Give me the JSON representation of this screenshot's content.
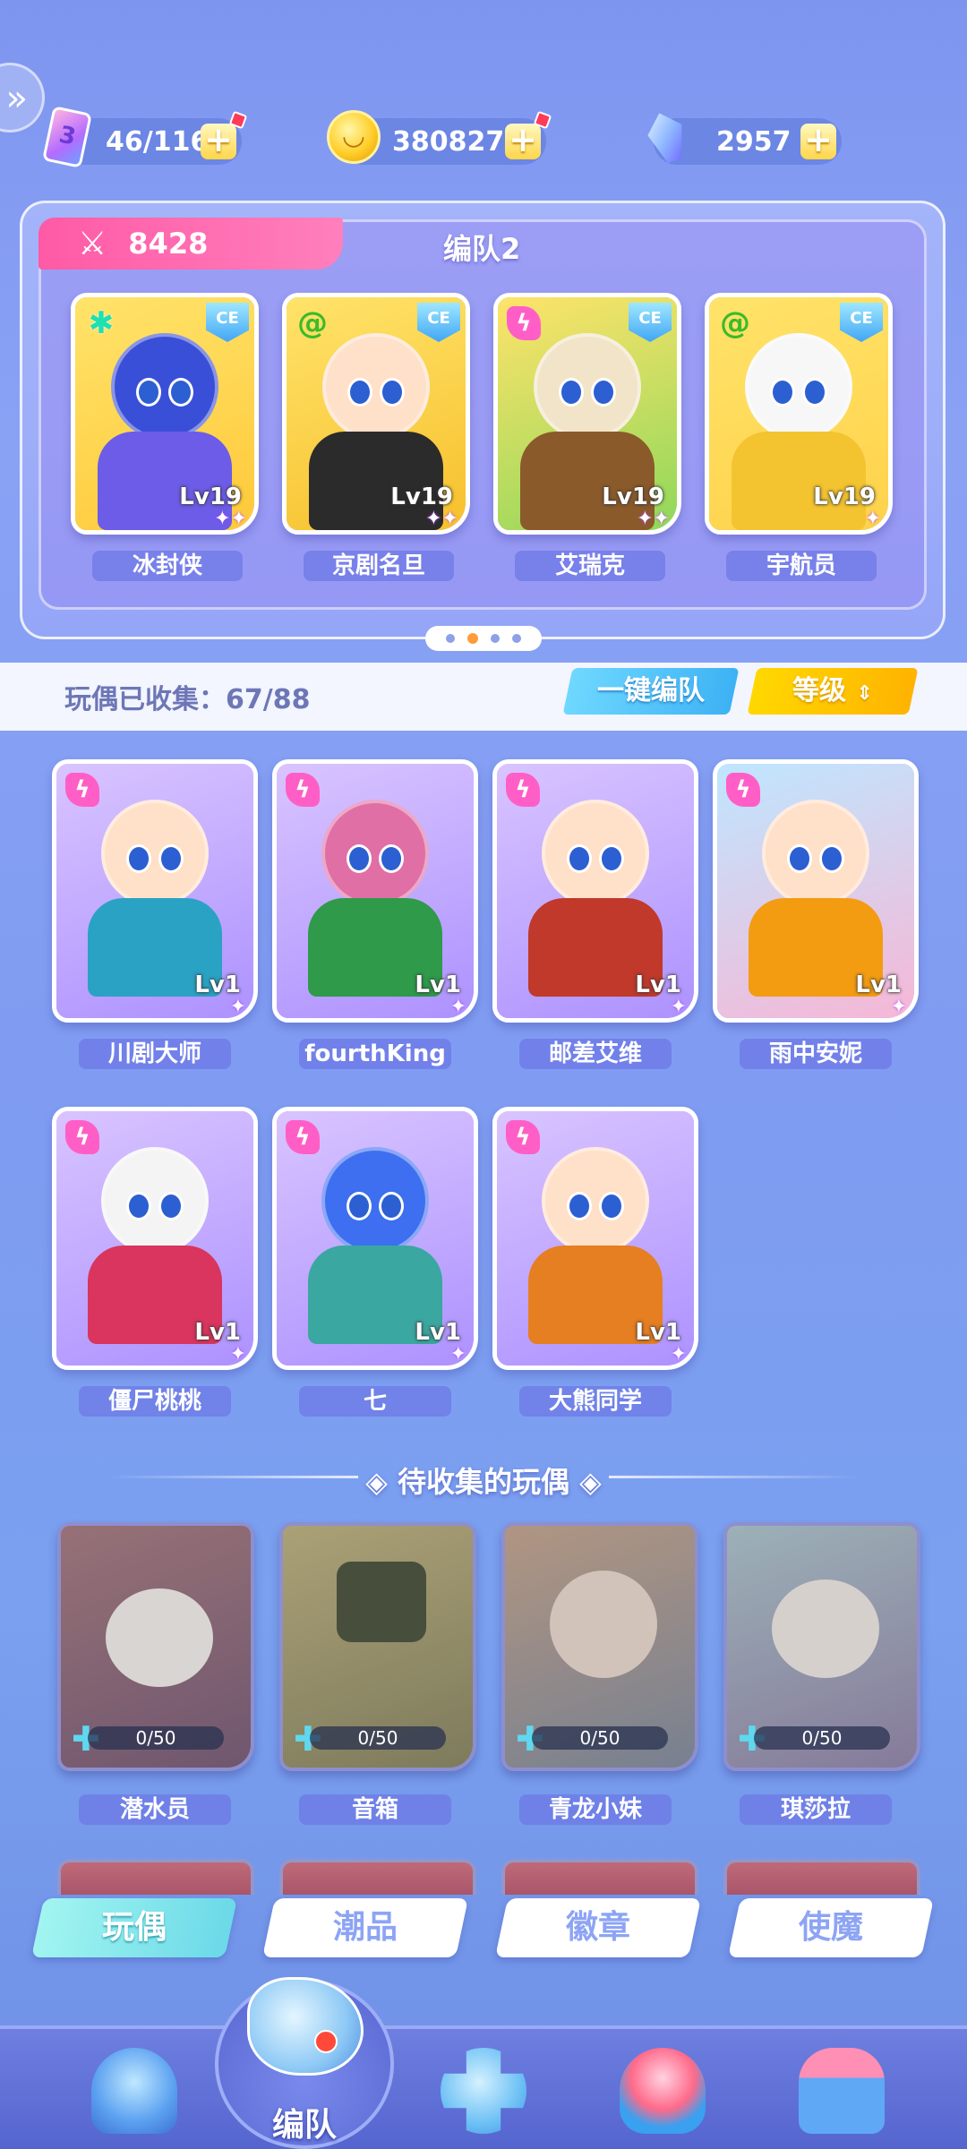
{
  "resources": {
    "energy": {
      "value": "46/116",
      "icon": "energy-ticket-icon"
    },
    "coins": {
      "value": "380827",
      "icon": "coin-icon"
    },
    "gems": {
      "value": "2957",
      "icon": "crystal-icon"
    }
  },
  "team": {
    "power": "8428",
    "title": "编队2",
    "page_dots": 4,
    "active_dot": 2,
    "members": [
      {
        "name": "冰封侠",
        "level": "Lv19",
        "element": "snow",
        "badge": "CE"
      },
      {
        "name": "京剧名旦",
        "level": "Lv19",
        "element": "spiral",
        "badge": "CE"
      },
      {
        "name": "艾瑞克",
        "level": "Lv19",
        "element": "bolt",
        "badge": "CE"
      },
      {
        "name": "宇航员",
        "level": "Lv19",
        "element": "spiral",
        "badge": "CE"
      }
    ]
  },
  "collection": {
    "label": "玩偶已收集：67/88",
    "auto_team_button": "一键编队",
    "sort_button": "等级"
  },
  "owned": [
    {
      "name": "川剧大师",
      "level": "Lv1",
      "element": "bolt"
    },
    {
      "name": "fourthKing",
      "level": "Lv1",
      "element": "bolt"
    },
    {
      "name": "邮差艾维",
      "level": "Lv1",
      "element": "bolt"
    },
    {
      "name": "雨中安妮",
      "level": "Lv1",
      "element": "bolt"
    },
    {
      "name": "僵尸桃桃",
      "level": "Lv1",
      "element": "bolt"
    },
    {
      "name": "七",
      "level": "Lv1",
      "element": "bolt"
    },
    {
      "name": "大熊同学",
      "level": "Lv1",
      "element": "bolt"
    }
  ],
  "to_collect": {
    "title": "待收集的玩偶",
    "items": [
      {
        "name": "潜水员",
        "progress": "0/50"
      },
      {
        "name": "音箱",
        "progress": "0/50"
      },
      {
        "name": "青龙小妹",
        "progress": "0/50"
      },
      {
        "name": "琪莎拉",
        "progress": "0/50"
      }
    ]
  },
  "category_tabs": [
    "玩偶",
    "潮品",
    "徽章",
    "使魔"
  ],
  "active_category": "玩偶",
  "bottom_nav": {
    "active_label": "编队",
    "items": [
      "home-icon",
      "team-whistle-icon",
      "puzzle-icon",
      "trophy-icon",
      "gacha-machine-icon"
    ]
  },
  "colors": {
    "power_tab": "#ff5aa6",
    "auto_button": "#3db2f4",
    "sort_button": "#ffb300",
    "active_tab": "#6bd9e8"
  }
}
